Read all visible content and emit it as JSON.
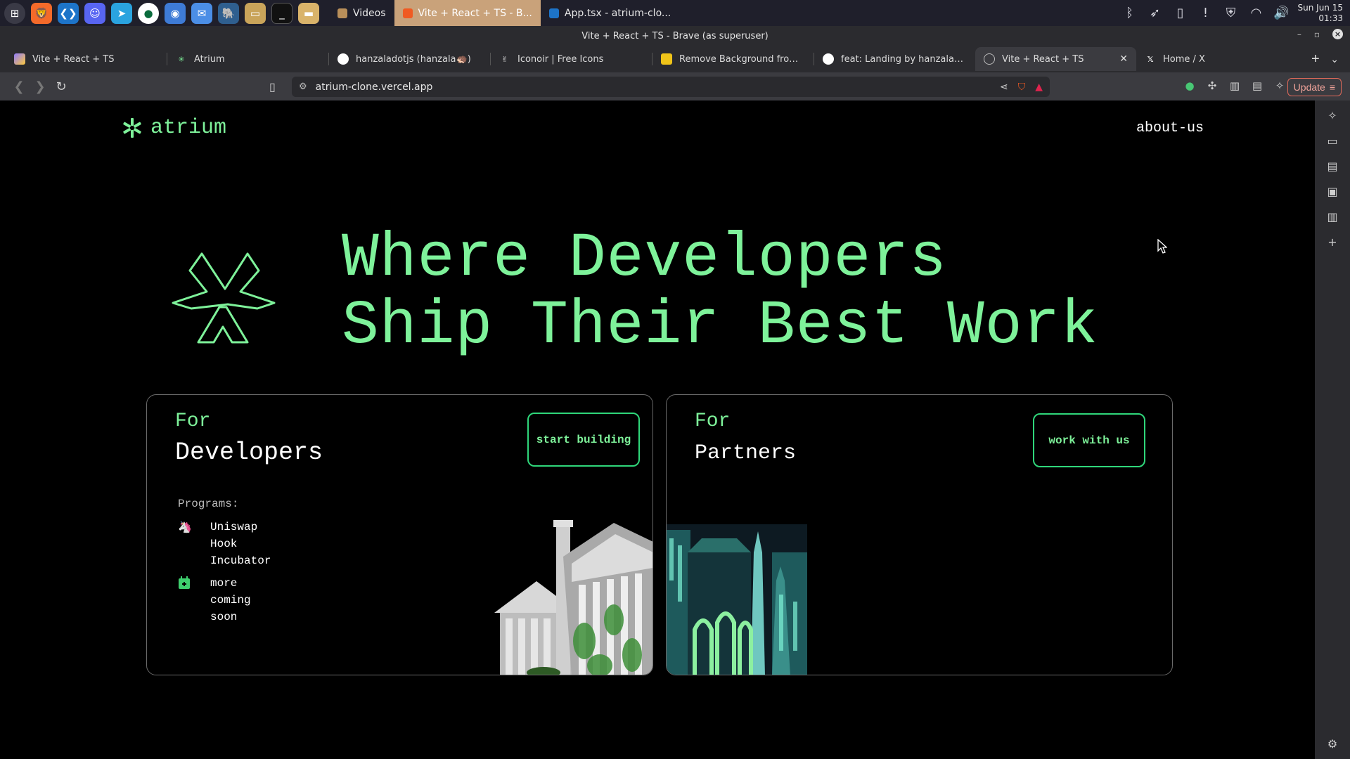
{
  "os": {
    "taskbar": [
      {
        "label": "Videos",
        "active": false
      },
      {
        "label": "Vite + React + TS - B...",
        "active": true
      },
      {
        "label": "App.tsx - atrium-clo...",
        "active": false
      }
    ],
    "clock_date": "Sun Jun 15",
    "clock_time": "01:33"
  },
  "window": {
    "title": "Vite + React + TS - Brave (as superuser)"
  },
  "tabs": [
    {
      "label": "Vite + React + TS",
      "favicon": "vite-icon"
    },
    {
      "label": "Atrium",
      "favicon": "atrium-icon"
    },
    {
      "label": "hanzaladotjs (hanzala🦔)",
      "favicon": "github-icon"
    },
    {
      "label": "Iconoir | Free Icons",
      "favicon": "iconoir-icon"
    },
    {
      "label": "Remove Background from Ima",
      "favicon": "removebg-icon"
    },
    {
      "label": "feat: Landing by hanzaladotjs",
      "favicon": "github-icon"
    },
    {
      "label": "Vite + React + TS",
      "favicon": "globe-icon",
      "active": true
    },
    {
      "label": "Home / X",
      "favicon": "x-icon"
    }
  ],
  "toolbar": {
    "url": "atrium-clone.vercel.app",
    "update_label": "Update"
  },
  "page": {
    "logo_text": "atrium",
    "nav_about": "about-us",
    "hero_line1": "Where Developers",
    "hero_line2": "Ship Their Best Work",
    "dev_card": {
      "for_label": "For",
      "title": "Developers",
      "cta": "start building",
      "programs_label": "Programs:",
      "programs": [
        {
          "lines": [
            "Uniswap",
            "Hook",
            "Incubator"
          ],
          "icon": "unicorn-icon"
        },
        {
          "lines": [
            "more",
            "coming",
            "soon"
          ],
          "icon": "calendar-plus-icon"
        }
      ]
    },
    "partner_card": {
      "for_label": "For",
      "title": "Partners",
      "cta": "work with us"
    }
  },
  "colors": {
    "accent": "#7ef29a",
    "cta_border": "#2fd67a",
    "background": "#000000"
  }
}
